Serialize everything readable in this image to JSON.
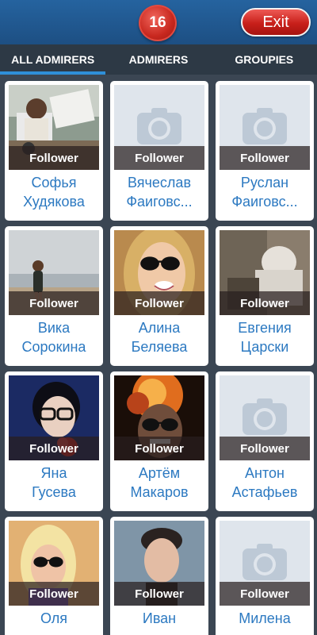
{
  "header": {
    "counter": "16",
    "exit_label": "Exit"
  },
  "tabs": [
    {
      "label": "ALL ADMIRERS",
      "active": true
    },
    {
      "label": "ADMIRERS",
      "active": false
    },
    {
      "label": "GROUPIES",
      "active": false
    }
  ],
  "cards": [
    {
      "first": "Софья",
      "last": "Худякова",
      "badge": "Follower",
      "photo": "photo-desk"
    },
    {
      "first": "Вячеслав",
      "last": "Фаиговс...",
      "badge": "Follower",
      "photo": "camera-placeholder"
    },
    {
      "first": "Руслан",
      "last": "Фаиговс...",
      "badge": "Follower",
      "photo": "camera-placeholder"
    },
    {
      "first": "Вика",
      "last": "Сорокина",
      "badge": "Follower",
      "photo": "photo-beach"
    },
    {
      "first": "Алина",
      "last": "Беляева",
      "badge": "Follower",
      "photo": "photo-sunglasses-blonde"
    },
    {
      "first": "Евгения",
      "last": "Царски",
      "badge": "Follower",
      "photo": "photo-room"
    },
    {
      "first": "Яна",
      "last": "Гусева",
      "badge": "Follower",
      "photo": "photo-glasses-flower"
    },
    {
      "first": "Артём",
      "last": "Макаров",
      "badge": "Follower",
      "photo": "photo-fire-sunglasses"
    },
    {
      "first": "Антон",
      "last": "Астафьев",
      "badge": "Follower",
      "photo": "camera-placeholder"
    },
    {
      "first": "Оля",
      "last": "",
      "badge": "Follower",
      "photo": "photo-blonde-sunglasses"
    },
    {
      "first": "Иван",
      "last": "",
      "badge": "Follower",
      "photo": "photo-man-haircut"
    },
    {
      "first": "Милена",
      "last": "",
      "badge": "Follower",
      "photo": "camera-placeholder"
    }
  ]
}
